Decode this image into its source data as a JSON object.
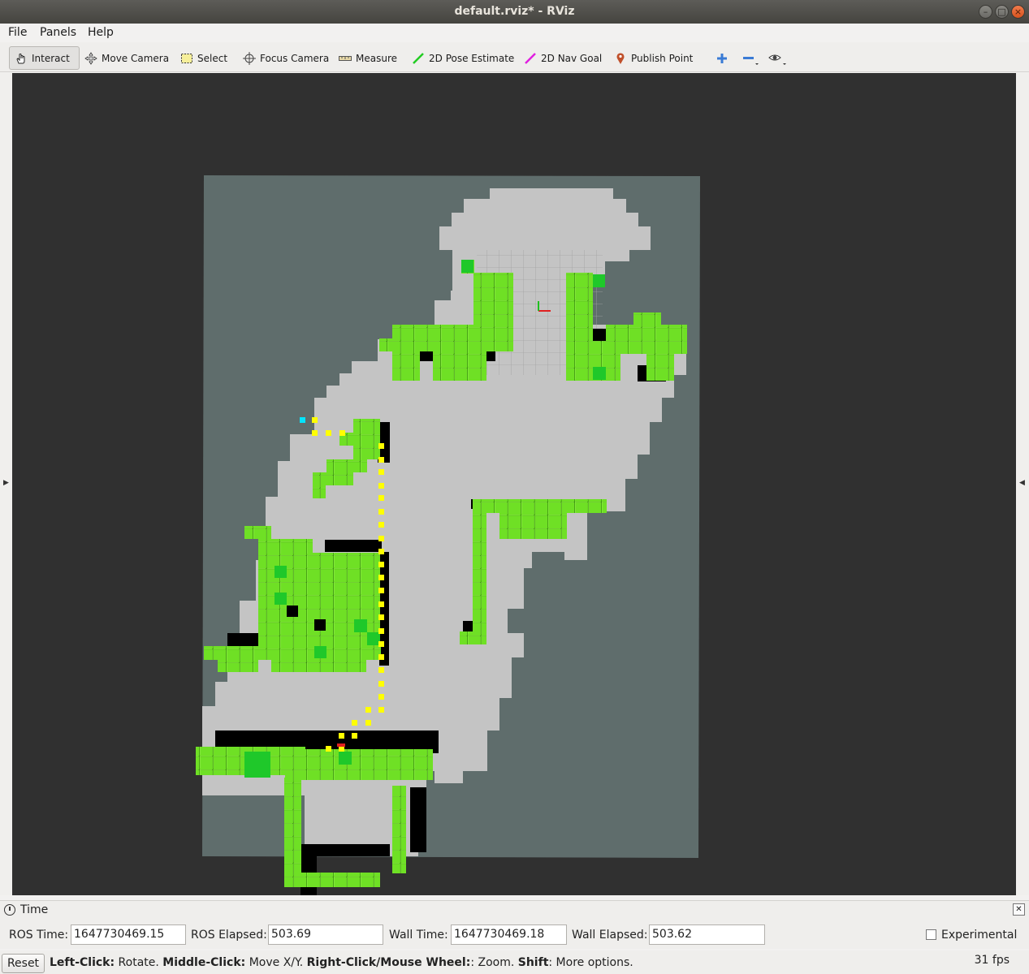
{
  "window": {
    "title": "default.rviz* - RViz",
    "min_glyph": "–",
    "max_glyph": "□",
    "close_glyph": "×"
  },
  "menu": [
    "File",
    "Panels",
    "Help"
  ],
  "toolbar": {
    "tools": [
      {
        "label": "Interact",
        "icon": "hand-icon",
        "active": true
      },
      {
        "label": "Move Camera",
        "icon": "move-camera-icon"
      },
      {
        "label": "Select",
        "icon": "select-icon"
      },
      {
        "label": "Focus Camera",
        "icon": "focus-camera-icon"
      },
      {
        "label": "Measure",
        "icon": "measure-icon"
      },
      {
        "label": "2D Pose Estimate",
        "icon": "pose-estimate-icon",
        "color": "#22cc22"
      },
      {
        "label": "2D Nav Goal",
        "icon": "nav-goal-icon",
        "color": "#e020e0"
      },
      {
        "label": "Publish Point",
        "icon": "publish-point-icon",
        "color": "#c0502a"
      }
    ]
  },
  "time_panel": {
    "title": "Time",
    "ros_time_label": "ROS Time:",
    "ros_time": "1647730469.15",
    "ros_elapsed_label": "ROS Elapsed:",
    "ros_elapsed": "503.69",
    "wall_time_label": "Wall Time:",
    "wall_time": "1647730469.18",
    "wall_elapsed_label": "Wall Elapsed:",
    "wall_elapsed": "503.62",
    "experimental_label": "Experimental",
    "experimental_checked": false
  },
  "status": {
    "reset_label": "Reset",
    "hint_parts": [
      {
        "text": "Left-Click:",
        "bold": true
      },
      {
        "text": " Rotate. ",
        "bold": false
      },
      {
        "text": "Middle-Click:",
        "bold": true
      },
      {
        "text": " Move X/Y. ",
        "bold": false
      },
      {
        "text": "Right-Click/Mouse Wheel:",
        "bold": true
      },
      {
        "text": ": Zoom. ",
        "bold": false
      },
      {
        "text": "Shift",
        "bold": true
      },
      {
        "text": ": More options.",
        "bold": false
      }
    ],
    "fps": "31 fps"
  },
  "colors": {
    "viewport_bg": "#303030",
    "map_unknown": "#5f6d6c",
    "map_free": "#c4c4c4",
    "obstacle_green": "#6fe025",
    "path_yellow": "#ffff00"
  }
}
